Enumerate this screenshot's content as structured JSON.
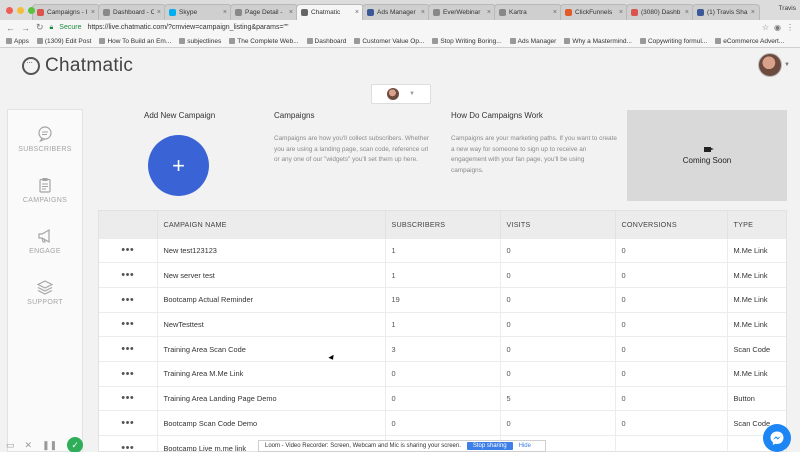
{
  "browser": {
    "tabs": [
      {
        "label": "Campaigns - I",
        "color": "#d9534f",
        "active": false
      },
      {
        "label": "Dashboard - C",
        "color": "#888888",
        "active": false
      },
      {
        "label": "Skype",
        "color": "#00aff0",
        "active": false
      },
      {
        "label": "Page Detail -",
        "color": "#888888",
        "active": false
      },
      {
        "label": "Chatmatic",
        "color": "#666666",
        "active": true
      },
      {
        "label": "Ads Manager",
        "color": "#3b5998",
        "active": false
      },
      {
        "label": "EverWebinar",
        "color": "#888888",
        "active": false
      },
      {
        "label": "Kartra",
        "color": "#888888",
        "active": false
      },
      {
        "label": "ClickFunnels",
        "color": "#e05a2a",
        "active": false
      },
      {
        "label": "(3080) Dashb",
        "color": "#d9534f",
        "active": false
      },
      {
        "label": "(1) Travis Sha",
        "color": "#3b5998",
        "active": false
      }
    ],
    "tab_overflow_label": "Travis",
    "secure_label": "Secure",
    "url": "https://live.chatmatic.com/?cmview=campaign_listing&params=\"\"",
    "bookmarks": [
      "Apps",
      "(1309) Edit Post",
      "How To Build an Em...",
      "subjectlines",
      "The Complete Web...",
      "Dashboard",
      "Customer Value Op...",
      "Stop Writing Boring...",
      "Ads Manager",
      "Why a Mastermind...",
      "Copywriting formul...",
      "eCommerce Advert..."
    ]
  },
  "header": {
    "logo_text": "Chatmatic"
  },
  "sidebar": {
    "items": [
      {
        "label": "SUBSCRIBERS",
        "icon": "chat-icon"
      },
      {
        "label": "CAMPAIGNS",
        "icon": "clipboard-icon"
      },
      {
        "label": "ENGAGE",
        "icon": "megaphone-icon"
      },
      {
        "label": "SUPPORT",
        "icon": "layers-icon"
      }
    ]
  },
  "cards": {
    "add_title": "Add New Campaign",
    "add_symbol": "+",
    "campaigns_title": "Campaigns",
    "campaigns_text": "Campaigns are how you'll collect subscribers. Whether you are using a landing page, scan code, reference url or any one of our \"widgets\" you'll set them up here.",
    "how_title": "How Do Campaigns Work",
    "how_text": "Campaigns are your marketing paths. If you want to create a new way for someone to sign up to receive an engagement with your fan page, you'll be using campaigns.",
    "video_label": "Coming Soon"
  },
  "table": {
    "headers": [
      "",
      "CAMPAIGN NAME",
      "SUBSCRIBERS",
      "VISITS",
      "CONVERSIONS",
      "TYPE"
    ],
    "row_menu": "•••",
    "rows": [
      {
        "name": "New test123123",
        "subscribers": "1",
        "visits": "0",
        "conversions": "0",
        "type": "M.Me Link"
      },
      {
        "name": "New server test",
        "subscribers": "1",
        "visits": "0",
        "conversions": "0",
        "type": "M.Me Link"
      },
      {
        "name": "Bootcamp Actual Reminder",
        "subscribers": "19",
        "visits": "0",
        "conversions": "0",
        "type": "M.Me Link"
      },
      {
        "name": "NewTesttest",
        "subscribers": "1",
        "visits": "0",
        "conversions": "0",
        "type": "M.Me Link"
      },
      {
        "name": "Training Area Scan Code",
        "subscribers": "3",
        "visits": "0",
        "conversions": "0",
        "type": "Scan Code"
      },
      {
        "name": "Training Area M.Me Link",
        "subscribers": "0",
        "visits": "0",
        "conversions": "0",
        "type": "M.Me Link"
      },
      {
        "name": "Training Area Landing Page Demo",
        "subscribers": "0",
        "visits": "5",
        "conversions": "0",
        "type": "Button"
      },
      {
        "name": "Bootcamp Scan Code Demo",
        "subscribers": "0",
        "visits": "0",
        "conversions": "0",
        "type": "Scan Code"
      },
      {
        "name": "Bootcamp Live m.me link",
        "subscribers": "",
        "visits": "",
        "conversions": "",
        "type": ""
      }
    ]
  },
  "loom": {
    "message": "Loom - Video Recorder: Screen, Webcam and Mic is sharing your screen.",
    "stop_label": "Stop sharing",
    "hide_label": "Hide"
  }
}
